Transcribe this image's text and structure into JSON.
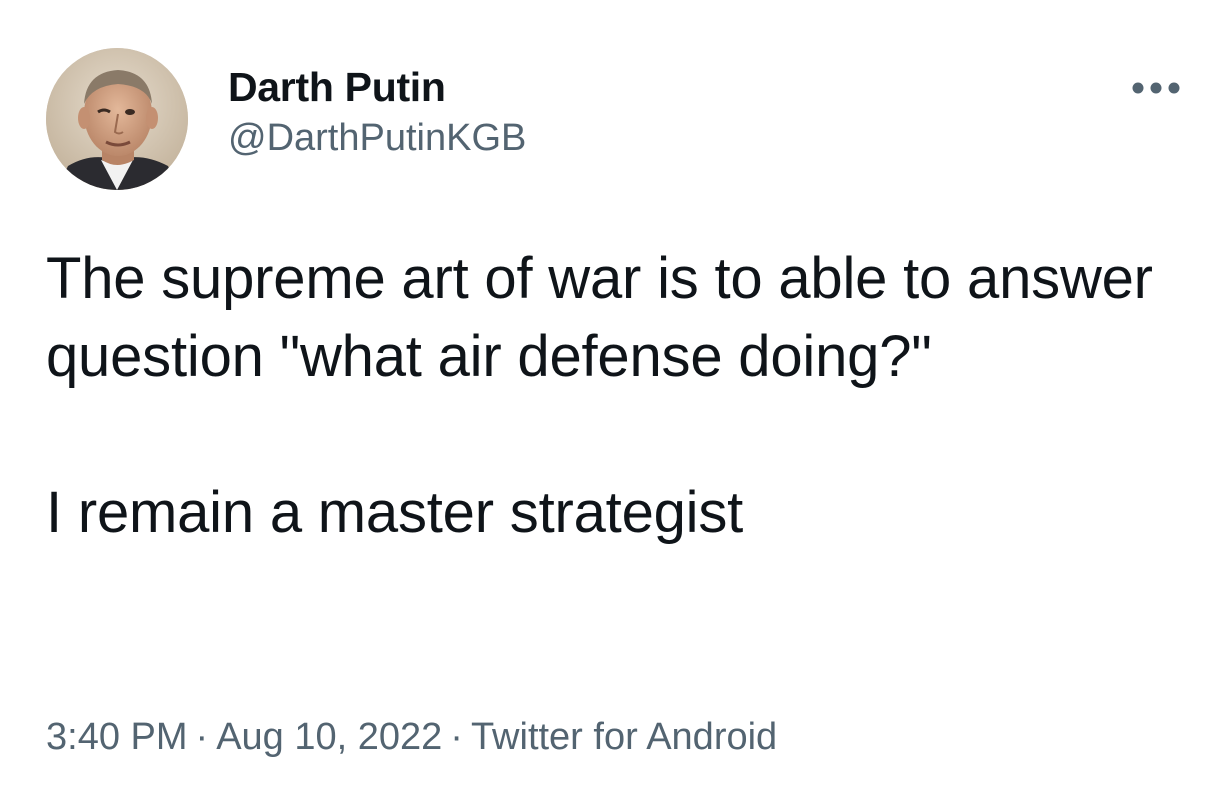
{
  "author": {
    "display_name": "Darth Putin",
    "handle": "@DarthPutinKGB",
    "avatar_icon": "profile-photo"
  },
  "menu": {
    "icon": "more-horizontal-icon"
  },
  "tweet": {
    "paragraph_1": "The supreme art of war is to able to answer question \"what air defense doing?\"",
    "paragraph_2": "I remain a master strategist"
  },
  "meta": {
    "time": "3:40 PM",
    "separator": "·",
    "date": "Aug 10, 2022",
    "source": "Twitter for Android"
  },
  "colors": {
    "text": "#0f1419",
    "secondary": "#536471",
    "background": "#ffffff"
  }
}
